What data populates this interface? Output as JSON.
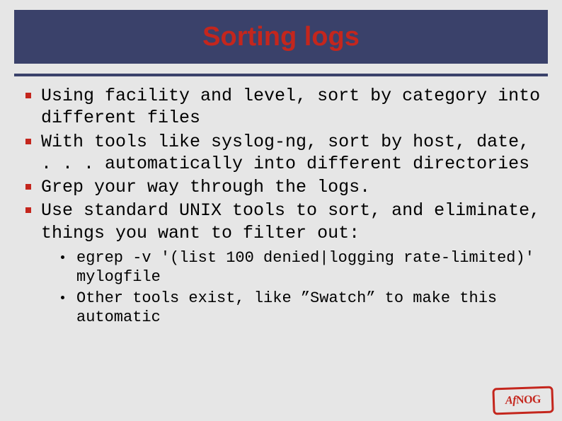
{
  "title": "Sorting logs",
  "bullets": [
    "Using facility and level, sort by category into different files",
    "With tools like syslog-ng, sort by host, date, . . . automatically into different directories",
    "Grep your way through the logs.",
    "Use standard UNIX tools to sort, and eliminate, things you want to filter out:"
  ],
  "sub_bullets": [
    "egrep -v '(list 100 denied|logging rate-limited)' mylogfile",
    "Other tools exist, like ”Swatch” to make this automatic"
  ],
  "stamp": {
    "part1": "Af",
    "part2": "NOG"
  }
}
